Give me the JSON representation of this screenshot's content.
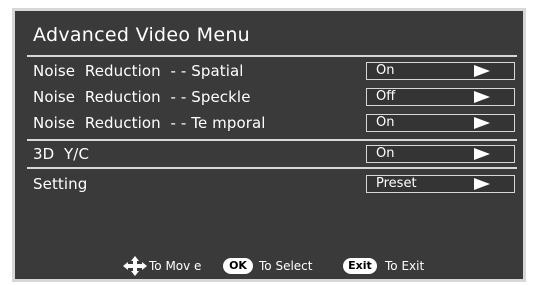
{
  "menu": {
    "title": "Advanced  Video  Menu",
    "rows": [
      {
        "label": "Noise  Reduction  - - Spatial",
        "value": "On",
        "arrow_icon": "right-triangle-icon"
      },
      {
        "label": "Noise  Reduction  - - Speckle",
        "value": "Off",
        "arrow_icon": "right-triangle-icon"
      },
      {
        "label": "Noise  Reduction  - - Te mporal",
        "value": "On",
        "arrow_icon": "right-triangle-icon"
      },
      {
        "label": "3D  Y/C",
        "value": "On",
        "arrow_icon": "right-triangle-icon"
      },
      {
        "label": "Setting",
        "value": "Preset",
        "arrow_icon": "right-triangle-icon"
      }
    ]
  },
  "footer": {
    "move_icon": "four-way-arrow-icon",
    "move_text": "To  Mov e",
    "ok_key": "OK",
    "select_text": "To  Select",
    "exit_key": "Exit",
    "exit_text": "To  Exit"
  },
  "colors": {
    "background": "#3a3a3a",
    "frame": "#d7d7d7",
    "text": "#ffffff",
    "badge": "#ffffff"
  }
}
